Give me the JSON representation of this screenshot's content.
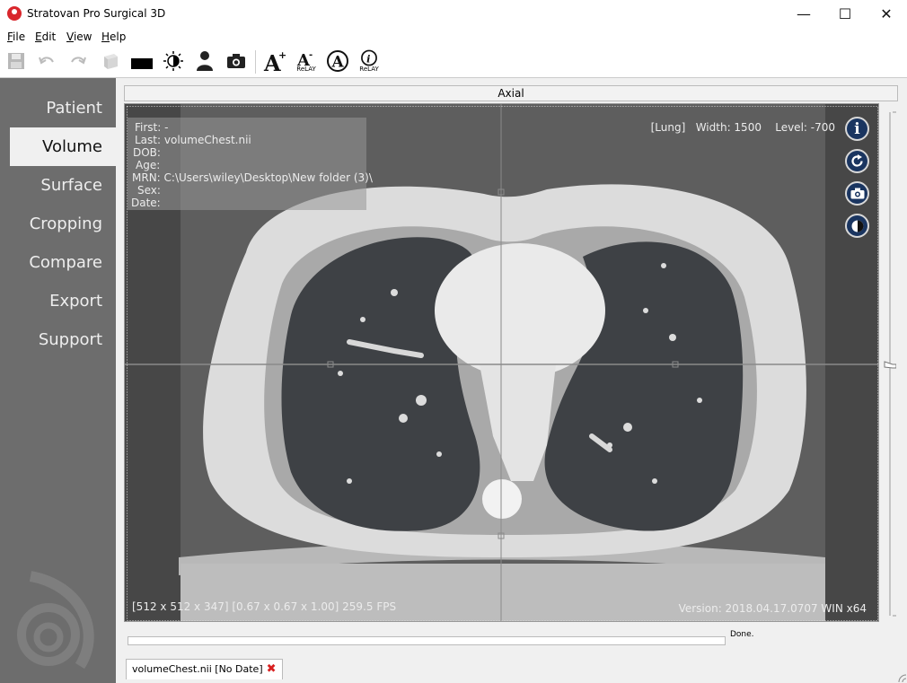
{
  "window": {
    "title": "Stratovan Pro Surgical 3D",
    "minimize": "—",
    "maximize": "☐",
    "close": "✕"
  },
  "menu": [
    "File",
    "Edit",
    "View",
    "Help"
  ],
  "toolbar": {
    "relay_small_label": "ReLAY",
    "relay_info_label": "ReLAY"
  },
  "sidebar": {
    "items": [
      {
        "label": "Patient"
      },
      {
        "label": "Volume",
        "active": true
      },
      {
        "label": "Surface"
      },
      {
        "label": "Cropping"
      },
      {
        "label": "Compare"
      },
      {
        "label": "Export"
      },
      {
        "label": "Support"
      }
    ]
  },
  "view": {
    "header": "Axial",
    "patient_info": {
      "first_label": "First:",
      "first_value": "-",
      "last_label": "Last:",
      "last_value": "volumeChest.nii",
      "dob_label": "DOB:",
      "age_label": "Age:",
      "mrn_label": "MRN:",
      "mrn_value": "C:\\Users\\wiley\\Desktop\\New folder (3)\\",
      "sex_label": "Sex:",
      "date_label": "Date:"
    },
    "window_level": "[Lung]   Width: 1500    Level: -700",
    "dimensions": "[512 x 512 x 347] [0.67 x 0.67 x 1.00] 259.5 FPS",
    "version": "Version: 2018.04.17.0707 WIN x64",
    "icons": [
      "info-icon",
      "reset-icon",
      "camera-icon",
      "contrast-icon"
    ]
  },
  "status": {
    "done": "Done."
  },
  "file_tab": {
    "label": "volumeChest.nii [No Date]",
    "close": "✖"
  }
}
